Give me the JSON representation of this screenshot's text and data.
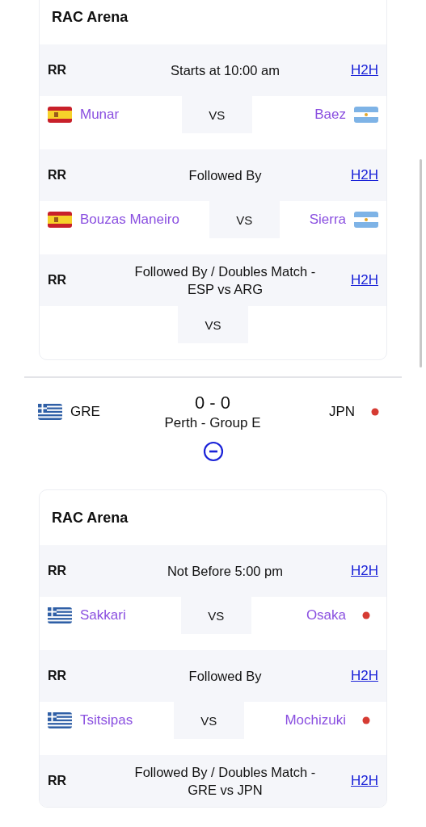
{
  "sections": [
    {
      "kind": "venue",
      "name": "RAC Arena",
      "matches": [
        {
          "round": "RR",
          "time": "Starts at 10:00 am",
          "link": "H2H",
          "separator": "VS",
          "player_1": {
            "name": "Munar",
            "kind": "esp"
          },
          "player_2": {
            "name": "Baez",
            "kind": "arg"
          }
        },
        {
          "round": "RR",
          "time": "Followed By",
          "link": "H2H",
          "separator": "VS",
          "player_1": {
            "name": "Bouzas Maneiro",
            "kind": "esp"
          },
          "player_2": {
            "name": "Sierra",
            "kind": "arg"
          }
        },
        {
          "round": "RR",
          "time": "Followed By / Doubles Match - ESP vs ARG",
          "link": "H2H",
          "separator": "VS"
        }
      ]
    },
    {
      "kind": "tie",
      "team_1": {
        "code": "GRE",
        "kind": "gre"
      },
      "score": "0 - 0",
      "subtitle": "Perth - Group E",
      "team_2": {
        "code": "JPN",
        "kind": "jpn"
      }
    },
    {
      "kind": "venue",
      "name": "RAC Arena",
      "matches": [
        {
          "round": "RR",
          "time": "Not Before 5:00 pm",
          "link": "H2H",
          "separator": "VS",
          "player_1": {
            "name": "Sakkari",
            "kind": "gre"
          },
          "player_2": {
            "name": "Osaka",
            "kind": "jpn"
          }
        },
        {
          "round": "RR",
          "time": "Followed By",
          "link": "H2H",
          "separator": "VS",
          "player_1": {
            "name": "Tsitsipas",
            "kind": "gre"
          },
          "player_2": {
            "name": "Mochizuki",
            "kind": "jpn"
          }
        },
        {
          "round": "RR",
          "time": "Followed By / Doubles Match - GRE vs JPN",
          "link": "H2H"
        }
      ]
    }
  ]
}
